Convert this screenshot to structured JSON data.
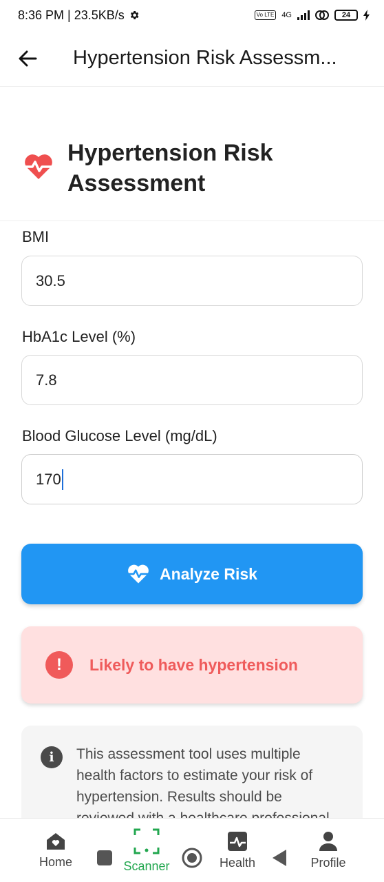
{
  "status_bar": {
    "time_speed": "8:36 PM | 23.5KB/s",
    "network": "4G",
    "volte": "Vo LTE",
    "battery": "24"
  },
  "app_bar": {
    "title": "Hypertension Risk Assessm..."
  },
  "header": {
    "title": "Hypertension Risk Assessment",
    "icon": "heartbeat-icon"
  },
  "form": {
    "bmi": {
      "label": "BMI",
      "value": "30.5"
    },
    "hba1c": {
      "label": "HbA1c Level (%)",
      "value": "7.8"
    },
    "glucose": {
      "label": "Blood Glucose Level (mg/dL)",
      "value": "170"
    }
  },
  "analyze_button": {
    "label": "Analyze Risk",
    "icon": "heartbeat-icon"
  },
  "result": {
    "text": "Likely to have hypertension",
    "icon": "exclamation-icon",
    "color": "#ef5b5b"
  },
  "info": {
    "text": "This assessment tool uses multiple health factors to estimate your risk of hypertension. Results should be reviewed with a healthcare professional.",
    "icon": "info-icon"
  },
  "bottom_nav": {
    "home": "Home",
    "scanner": "Scanner",
    "health": "Health",
    "profile": "Profile"
  },
  "colors": {
    "primary": "#2196f3",
    "active_nav": "#22a74f",
    "danger": "#ef5b5b",
    "danger_bg": "#ffe0e0"
  }
}
